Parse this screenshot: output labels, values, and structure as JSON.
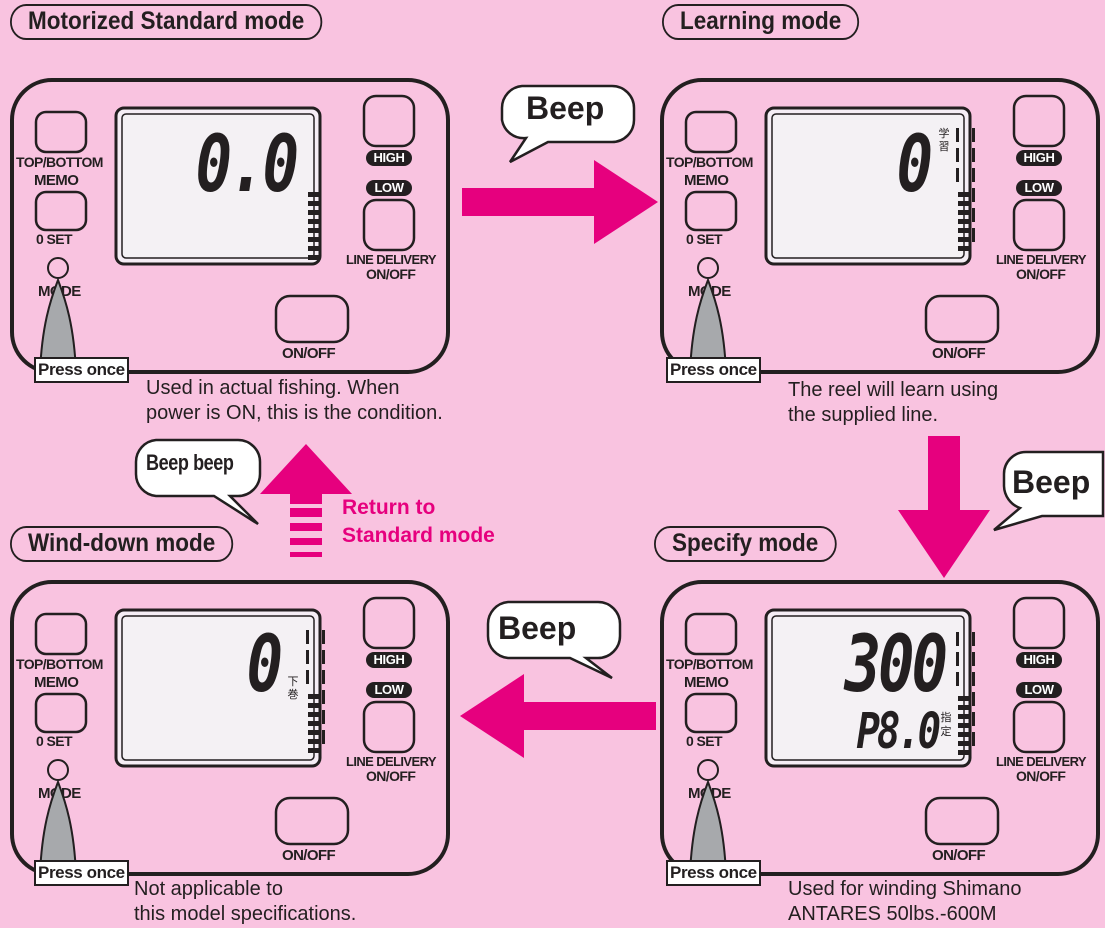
{
  "colors": {
    "background": "#f9c3e0",
    "arrow": "#e6007e",
    "panel": "#f9c3e0",
    "outline": "#231f20"
  },
  "labels": {
    "top_bottom": "TOP/BOTTOM",
    "memo": "MEMO",
    "zero_set": "0 SET",
    "mode": "MODE",
    "high": "HIGH",
    "low": "LOW",
    "line_delivery": "LINE DELIVERY",
    "line_delivery_onoff": "ON/OFF",
    "onoff": "ON/OFF",
    "press_once": "Press once"
  },
  "modes": {
    "standard": {
      "title": "Motorized Standard mode",
      "display": "0.0",
      "desc1": "Used in actual fishing. When",
      "desc2": "power is ON, this is the condition."
    },
    "learning": {
      "title": "Learning mode",
      "display": "0",
      "kanji1": "学",
      "kanji2": "習",
      "desc1": "The reel will learn using",
      "desc2": "the supplied line."
    },
    "specify": {
      "title": "Specify mode",
      "display": "300",
      "display2": "P8.0",
      "kanji1": "指",
      "kanji2": "定",
      "desc1": "Used for winding Shimano",
      "desc2": "ANTARES 50lbs.-600M"
    },
    "winddown": {
      "title": "Wind-down mode",
      "display": "0",
      "kanji1": "下",
      "kanji2": "巻",
      "desc1": "Not applicable to",
      "desc2": "this model specifications."
    }
  },
  "bubbles": {
    "beep_top": "Beep",
    "beep_right": "Beep",
    "beep_bottom": "Beep",
    "beep_beep": "Beep beep"
  },
  "return_text": {
    "line1": "Return to",
    "line2": "Standard mode"
  }
}
